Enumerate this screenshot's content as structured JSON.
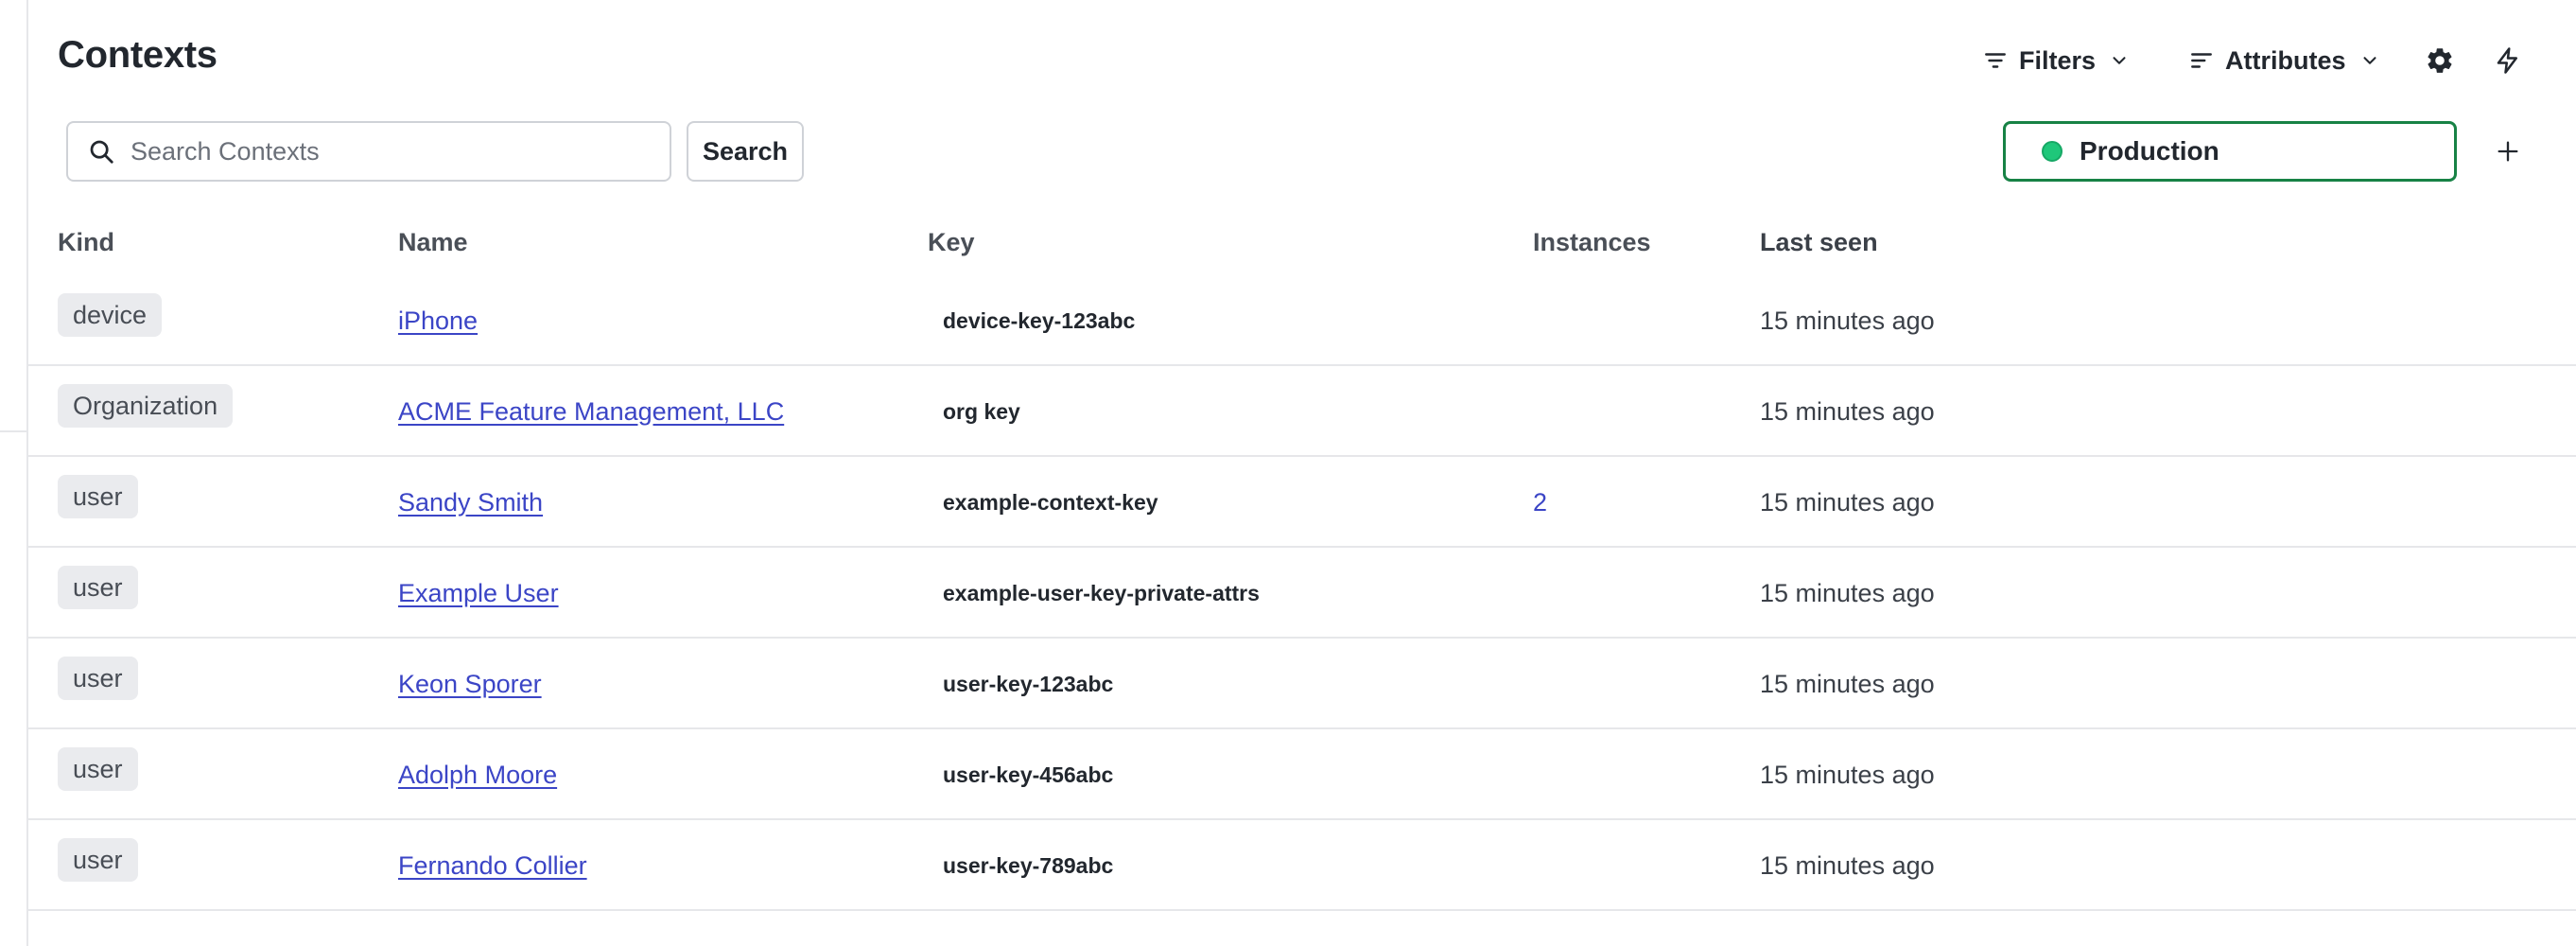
{
  "header": {
    "title": "Contexts",
    "filters_label": "Filters",
    "attributes_label": "Attributes"
  },
  "search": {
    "placeholder": "Search Contexts",
    "value": "",
    "button_label": "Search"
  },
  "environment": {
    "name": "Production",
    "status_color": "#1fc77a",
    "border_color": "#178245"
  },
  "icons": {
    "search": "search-icon",
    "filters": "filter-lines-icon",
    "attributes": "sort-lines-icon",
    "chevron": "chevron-down-icon",
    "settings": "gear-icon",
    "flash": "lightning-bolt-icon",
    "add": "plus-icon"
  },
  "colors": {
    "link": "#3b45c6",
    "badge_bg": "#eaebee"
  },
  "table": {
    "columns": [
      "Kind",
      "Name",
      "Key",
      "Instances",
      "Last seen"
    ],
    "rows": [
      {
        "kind": "device",
        "name": "iPhone",
        "key": "device-key-123abc",
        "instances": "",
        "last_seen": "15 minutes ago"
      },
      {
        "kind": "Organization",
        "name": "ACME Feature Management, LLC",
        "key": "org key",
        "instances": "",
        "last_seen": "15 minutes ago"
      },
      {
        "kind": "user",
        "name": "Sandy Smith",
        "key": "example-context-key",
        "instances": "2",
        "last_seen": "15 minutes ago"
      },
      {
        "kind": "user",
        "name": "Example User",
        "key": "example-user-key-private-attrs",
        "instances": "",
        "last_seen": "15 minutes ago"
      },
      {
        "kind": "user",
        "name": "Keon Sporer",
        "key": "user-key-123abc",
        "instances": "",
        "last_seen": "15 minutes ago"
      },
      {
        "kind": "user",
        "name": "Adolph Moore",
        "key": "user-key-456abc",
        "instances": "",
        "last_seen": "15 minutes ago"
      },
      {
        "kind": "user",
        "name": "Fernando Collier",
        "key": "user-key-789abc",
        "instances": "",
        "last_seen": "15 minutes ago"
      }
    ]
  }
}
